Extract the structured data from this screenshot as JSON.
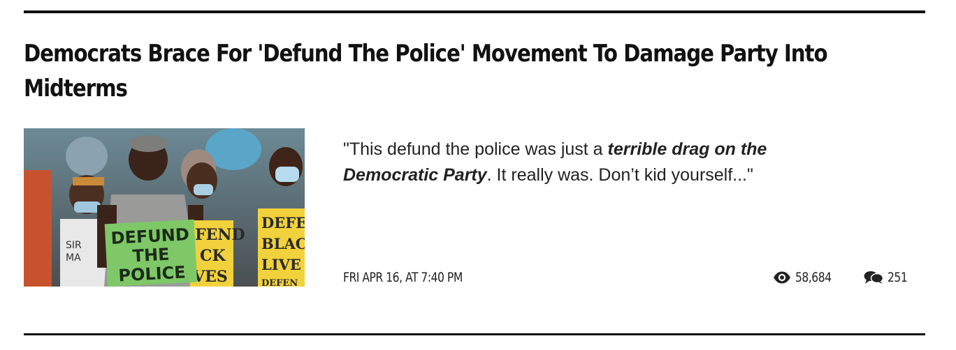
{
  "article": {
    "title_line1": "Democrats Brace For 'Defund The Police' Movement To Damage Party Into",
    "title_line2": "Midterms",
    "excerpt_pre": "\"This defund the police was just a ",
    "excerpt_emph_1": "terrible drag on the",
    "excerpt_emph_2": "Democratic Party",
    "excerpt_post": ". It really was. Don’t kid yourself...\"",
    "date": "FRI APR 16, AT 7:40 PM",
    "views": "58,684",
    "comments": "251"
  },
  "photo": {
    "sign_green": [
      "DEFUND",
      "THE",
      "POLICE"
    ],
    "sign_yellow_left": [
      "FEND",
      "CK",
      "VES"
    ],
    "sign_yellow_right": [
      "DEFEN",
      "BLAC",
      "LIVE",
      "DEFEN"
    ],
    "shirt_text": [
      "SIR",
      "MA"
    ]
  },
  "icons": {
    "views": "eye-icon",
    "comments": "speech-bubbles-icon"
  },
  "colors": {
    "rule": "#111111",
    "text": "#222222",
    "sign_green": "#7ec867",
    "sign_yellow": "#f1d23c"
  }
}
